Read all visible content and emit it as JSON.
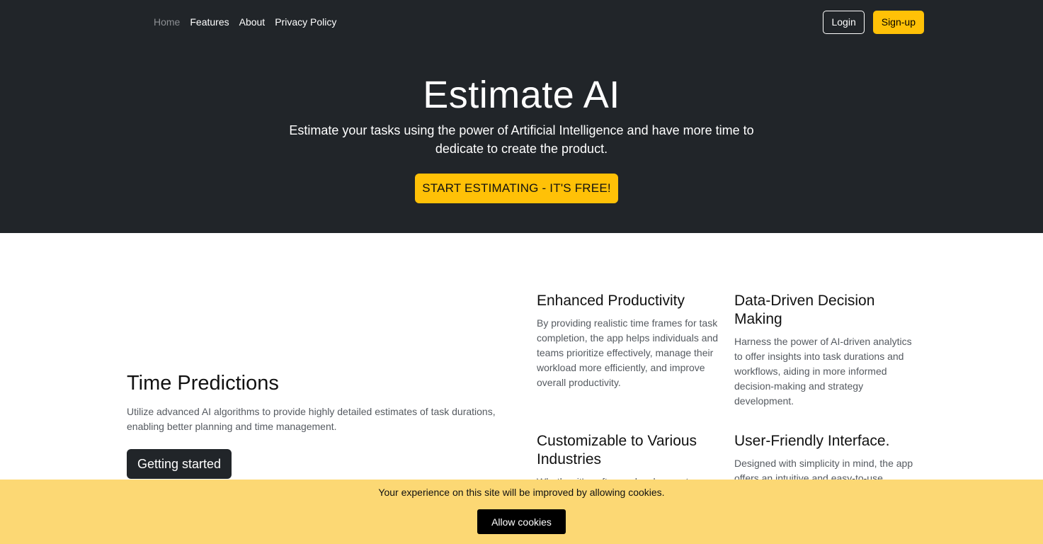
{
  "nav": {
    "links": [
      "Home",
      "Features",
      "About",
      "Privacy Policy"
    ],
    "active": "Home",
    "login_label": "Login",
    "signup_label": "Sign-up"
  },
  "hero": {
    "title": "Estimate AI",
    "subtitle": "Estimate your tasks using the power of Artificial Intelligence and have more time to dedicate to create the product.",
    "cta_label": "START ESTIMATING - IT'S FREE!"
  },
  "main": {
    "title": "Time Predictions",
    "description": "Utilize advanced AI algorithms to provide highly detailed estimates of task durations, enabling better planning and time management.",
    "button_label": "Getting started"
  },
  "features": [
    {
      "title": "Enhanced Productivity",
      "text": "By providing realistic time frames for task completion, the app helps individuals and teams prioritize effectively, manage their workload more efficiently, and improve overall productivity."
    },
    {
      "title": "Data-Driven Decision Making",
      "text": "Harness the power of AI-driven analytics to offer insights into task durations and workflows, aiding in more informed decision-making and strategy development."
    },
    {
      "title": "Customizable to Various Industries",
      "text": "Whether it's software development"
    },
    {
      "title": "User-Friendly Interface.",
      "text": "Designed with simplicity in mind, the app offers an intuitive and easy-to-use"
    }
  ],
  "cookie": {
    "text": "Your experience on this site will be improved by allowing cookies.",
    "button_label": "Allow cookies"
  },
  "colors": {
    "header_bg": "#212529",
    "accent": "#ffc107",
    "cookie_bg": "#fcd874"
  }
}
